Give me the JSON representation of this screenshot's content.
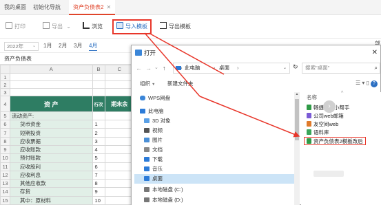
{
  "tabs": [
    {
      "label": "我的桌面"
    },
    {
      "label": "初始化导航"
    },
    {
      "label": "资产负债表2",
      "close": "✕"
    }
  ],
  "toolbar": {
    "print": "打印",
    "export": "导出",
    "export_dd": "⌄",
    "browse": "浏览",
    "import_template": "导入模板",
    "export_template": "导出模板"
  },
  "period": {
    "year": "2022年",
    "year_dd": "⌄",
    "months": [
      "1月",
      "2月",
      "3月",
      "4月"
    ],
    "active_month": "4月"
  },
  "sheet": {
    "title": "资产负债表",
    "columns": [
      "A",
      "B",
      "C"
    ],
    "header": {
      "col_a": "资  产",
      "col_b": "行次",
      "col_c": "期末余"
    },
    "rows": [
      {
        "n": "1",
        "a": "",
        "b": "",
        "green": false
      },
      {
        "n": "2",
        "a": "",
        "b": "",
        "green": false
      },
      {
        "n": "3",
        "a": "",
        "b": "",
        "green": false
      },
      {
        "n": "4",
        "a": "",
        "b": "",
        "header": true
      },
      {
        "n": "5",
        "a": "流动资产:",
        "b": "",
        "green": true,
        "indent": false
      },
      {
        "n": "6",
        "a": "货币资金",
        "b": "1",
        "green": true,
        "indent": true
      },
      {
        "n": "7",
        "a": "短期投资",
        "b": "2",
        "green": true,
        "indent": true
      },
      {
        "n": "8",
        "a": "应收票据",
        "b": "3",
        "green": true,
        "indent": true
      },
      {
        "n": "9",
        "a": "应收账款",
        "b": "4",
        "green": true,
        "indent": true
      },
      {
        "n": "10",
        "a": "预付账款",
        "b": "5",
        "green": true,
        "indent": true
      },
      {
        "n": "11",
        "a": "应收股利",
        "b": "6",
        "green": true,
        "indent": true
      },
      {
        "n": "12",
        "a": "应收利息",
        "b": "7",
        "green": true,
        "indent": true
      },
      {
        "n": "13",
        "a": "其他应收款",
        "b": "8",
        "green": true,
        "indent": true
      },
      {
        "n": "14",
        "a": "存货",
        "b": "9",
        "green": true,
        "indent": true
      },
      {
        "n": "15",
        "a": "其中：原材料",
        "b": "10",
        "green": true,
        "indent": true
      }
    ]
  },
  "edge": {
    "right_top": "部",
    "right_x": "×"
  },
  "dialog": {
    "title": "打开",
    "close": "✕",
    "nav_back": "←",
    "nav_forward": "→",
    "nav_down": "⌄",
    "nav_up": "↑",
    "path": [
      "此电脑",
      "桌面"
    ],
    "path_sep": "›",
    "path_dd": "⌄",
    "refresh": "↻",
    "search_placeholder": "搜索\"桌面\"",
    "search_icon": "⌕",
    "organize": "组织",
    "new_folder": "新建文件夹",
    "view": "☰ ▾ ▯",
    "help": "?",
    "nav_items": [
      {
        "label": "WPS网盘",
        "icon": "cloud-icon",
        "color": "#3b86d8"
      },
      {
        "label": "此电脑",
        "icon": "computer-icon",
        "color": "#2c7bd8"
      },
      {
        "label": "3D 对象",
        "icon": "cube-icon",
        "color": "#5aa0e6"
      },
      {
        "label": "视频",
        "icon": "video-icon",
        "color": "#555555"
      },
      {
        "label": "图片",
        "icon": "picture-icon",
        "color": "#4a8fd6"
      },
      {
        "label": "文档",
        "icon": "document-icon",
        "color": "#888888"
      },
      {
        "label": "下载",
        "icon": "download-icon",
        "color": "#2c7bd8"
      },
      {
        "label": "音乐",
        "icon": "music-icon",
        "color": "#2c7bd8"
      },
      {
        "label": "桌面",
        "icon": "desktop-icon",
        "color": "#2c7bd8",
        "selected": true
      },
      {
        "label": "本地磁盘 (C:)",
        "icon": "drive-icon",
        "color": "#777777"
      },
      {
        "label": "本地磁盘 (D:)",
        "icon": "drive-icon",
        "color": "#777777"
      }
    ],
    "list_header": "名称",
    "list_sort": "^",
    "files": [
      {
        "label": "畅捷家园小帮手",
        "icon": "app-icon",
        "color": "#2f9a46"
      },
      {
        "label": "公司web邮箱",
        "icon": "link-icon",
        "color": "#7b5bd6"
      },
      {
        "label": "友空间web",
        "icon": "link-icon",
        "color": "#e07b2b"
      },
      {
        "label": "语料库",
        "icon": "file-icon",
        "color": "#3aa659"
      },
      {
        "label": "资产负债表2模板改后",
        "icon": "excel-file-icon",
        "color": "#2f9a46",
        "selected": true
      }
    ],
    "next_button": "›"
  }
}
